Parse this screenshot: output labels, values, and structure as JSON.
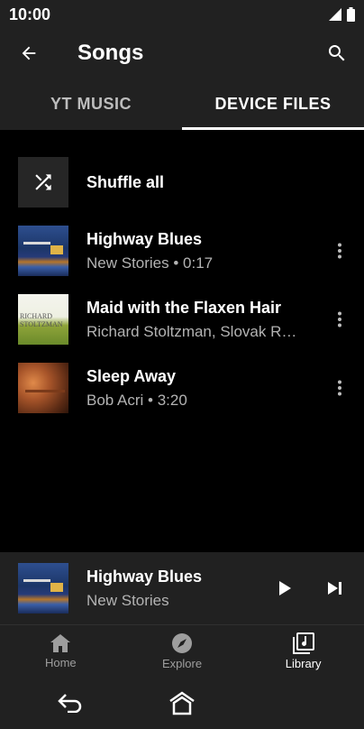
{
  "status_bar": {
    "time": "10:00"
  },
  "app_bar": {
    "title": "Songs"
  },
  "tabs": [
    {
      "label": "YT MUSIC",
      "active": false
    },
    {
      "label": "DEVICE FILES",
      "active": true
    }
  ],
  "shuffle": {
    "label": "Shuffle all"
  },
  "songs": [
    {
      "title": "Highway Blues",
      "subtitle": "New Stories • 0:17",
      "art": "blue-night-cover"
    },
    {
      "title": "Maid with the Flaxen Hair",
      "subtitle": "Richard Stoltzman, Slovak R…",
      "art": "green-stoltzman-cover",
      "art_text_1": "RICHARD",
      "art_text_2": "STOLTZMAN"
    },
    {
      "title": "Sleep Away",
      "subtitle": "Bob Acri • 3:20",
      "art": "orange-piano-cover"
    }
  ],
  "mini_player": {
    "title": "Highway Blues",
    "subtitle": "New Stories"
  },
  "bottom_nav": [
    {
      "label": "Home",
      "icon": "home-icon",
      "active": false
    },
    {
      "label": "Explore",
      "icon": "compass-icon",
      "active": false
    },
    {
      "label": "Library",
      "icon": "library-icon",
      "active": true
    }
  ],
  "colors": {
    "background": "#000000",
    "surface": "#212121",
    "secondary_text": "#b3b3b3"
  }
}
